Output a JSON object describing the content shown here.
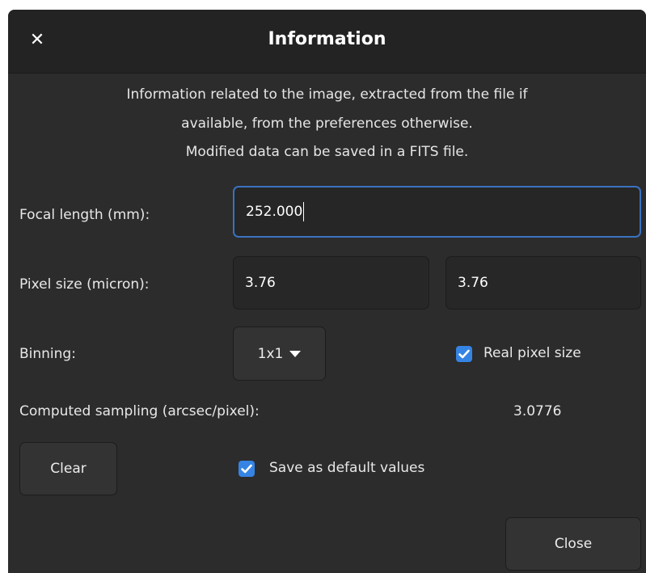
{
  "dialog": {
    "title": "Information",
    "close_icon": "close-icon",
    "description": [
      "Information related to the image, extracted from the file if",
      "available, from the preferences otherwise.",
      "Modified data can be saved in a FITS file."
    ]
  },
  "form": {
    "focal_length": {
      "label": "Focal length (mm):",
      "value": "252.000"
    },
    "pixel_size": {
      "label": "Pixel size (micron):",
      "value_x": "3.76",
      "value_y": "3.76"
    },
    "binning": {
      "label": "Binning:",
      "value": "1x1",
      "icon": "triangle-down-icon"
    },
    "real_pixel_size": {
      "label": "Real pixel size",
      "checked": true
    },
    "sampling": {
      "label": "Computed sampling (arcsec/pixel):",
      "value": "3.0776"
    }
  },
  "buttons": {
    "clear": "Clear",
    "close": "Close"
  },
  "save_default": {
    "label": "Save as default values",
    "checked": true
  },
  "colors": {
    "accent": "#3584e4",
    "focus_border": "#3a72bf",
    "background": "#2c2c2c",
    "titlebar": "#232323"
  }
}
